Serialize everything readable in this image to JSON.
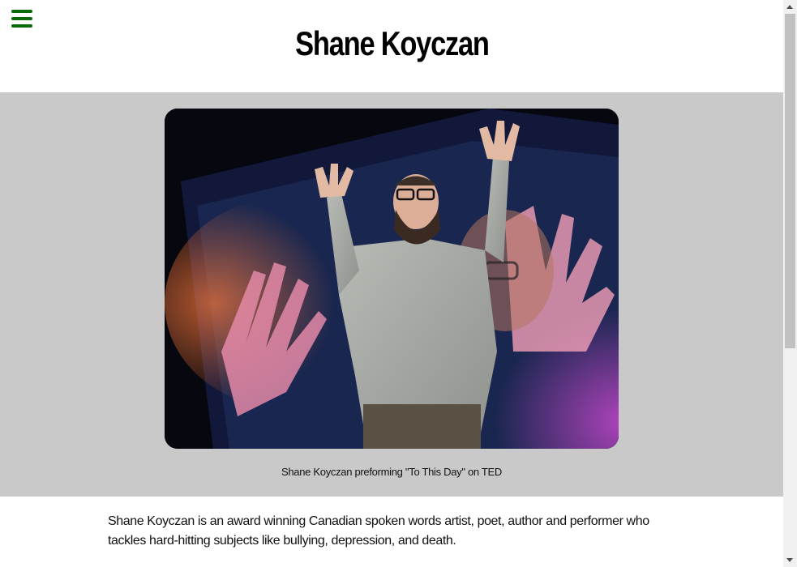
{
  "header": {
    "title": "Shane Koyczan",
    "menu_icon": "hamburger-menu-icon",
    "accent_color": "#0b6b0b"
  },
  "figure": {
    "image_alt": "Shane Koyczan performing on stage with raised hands in front of a colorful screen",
    "caption": "Shane Koyczan preforming \"To This Day\" on TED",
    "band_color": "#c9c9c9"
  },
  "content": {
    "intro": "Shane Koyczan is an award winning Canadian spoken words artist, poet, author and performer who tackles hard-hitting subjects like bullying, depression, and death."
  }
}
